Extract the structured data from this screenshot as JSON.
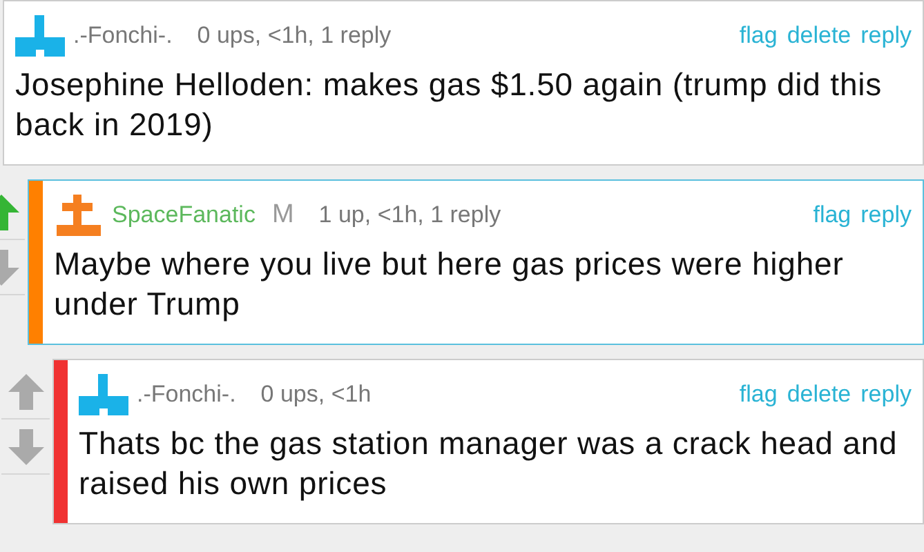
{
  "comments": [
    {
      "author": {
        "name": ".-Fonchi-.",
        "color": "#777777"
      },
      "avatar": {
        "kind": "tee",
        "color": "#1ab2e8"
      },
      "meta": "0 ups, <1h, 1 reply",
      "actions": [
        "flag",
        "delete",
        "reply"
      ],
      "text": "Josephine Helloden: makes gas $1.50 again (trump did this back in 2019)",
      "highlighted": false,
      "children": [
        {
          "author": {
            "name": "SpaceFanatic",
            "color": "#5cb85c"
          },
          "badge": "M",
          "avatar": {
            "kind": "cross",
            "color": "#f57f20"
          },
          "bar": {
            "color": "#ff8000"
          },
          "meta": "1 up, <1h, 1 reply",
          "actions": [
            "flag",
            "reply"
          ],
          "text": "Maybe where you live but here gas prices were higher under Trump",
          "highlighted": true,
          "votes": {
            "up": true,
            "down": false
          },
          "children": [
            {
              "author": {
                "name": ".-Fonchi-.",
                "color": "#777777"
              },
              "avatar": {
                "kind": "tee",
                "color": "#1ab2e8"
              },
              "bar": {
                "color": "#f03232"
              },
              "meta": "0 ups, <1h",
              "actions": [
                "flag",
                "delete",
                "reply"
              ],
              "text": "Thats bc the gas station manager was a crack head and raised his own prices",
              "highlighted": false,
              "votes": {
                "up": false,
                "down": false
              }
            }
          ]
        }
      ]
    }
  ]
}
